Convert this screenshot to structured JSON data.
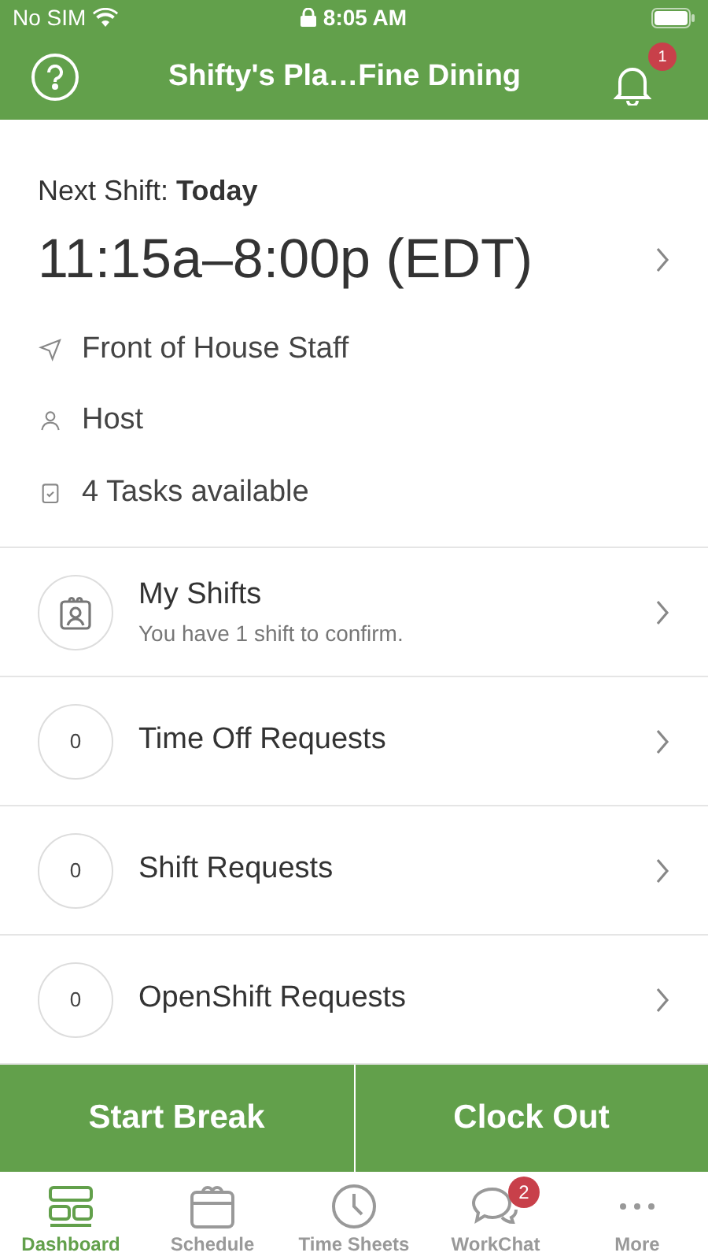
{
  "status_bar": {
    "carrier": "No SIM",
    "time": "8:05 AM"
  },
  "header": {
    "title": "Shifty's Pla…Fine Dining",
    "notification_badge": "1"
  },
  "next_shift": {
    "label": "Next Shift:",
    "day": "Today",
    "time": "11:15a–8:00p (EDT)",
    "details": [
      {
        "kind": "location",
        "text": "Front of House Staff"
      },
      {
        "kind": "role",
        "text": "Host"
      },
      {
        "kind": "tasks",
        "text": "4 Tasks available"
      }
    ]
  },
  "list": [
    {
      "kind": "icon",
      "title": "My Shifts",
      "subtitle": "You have 1 shift to confirm."
    },
    {
      "kind": "count",
      "count": "0",
      "title": "Time Off Requests"
    },
    {
      "kind": "count",
      "count": "0",
      "title": "Shift Requests"
    },
    {
      "kind": "count",
      "count": "0",
      "title": "OpenShift Requests"
    }
  ],
  "actions": [
    "Start Break",
    "Clock Out"
  ],
  "tab_bar": [
    {
      "kind": "dashboard",
      "label": "Dashboard",
      "selected": true
    },
    {
      "kind": "schedule",
      "label": "Schedule",
      "selected": false
    },
    {
      "kind": "timesheets",
      "label": "Time Sheets",
      "selected": false
    },
    {
      "kind": "chat",
      "label": "WorkChat",
      "selected": false,
      "badge": "2"
    },
    {
      "kind": "more",
      "label": "More",
      "selected": false
    }
  ]
}
